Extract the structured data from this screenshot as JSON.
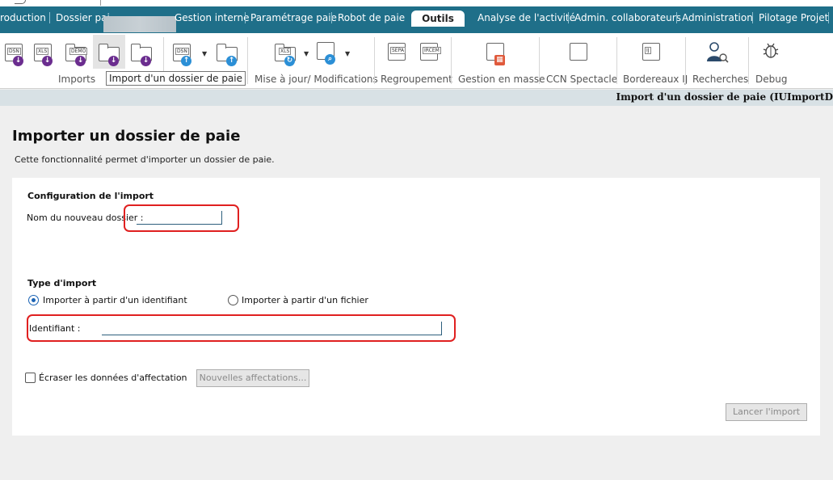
{
  "nav": {
    "tabs": [
      {
        "label": "roduction"
      },
      {
        "label": "Dossier pai"
      },
      {
        "label": "Gestion interne"
      },
      {
        "label": "Paramétrage paie"
      },
      {
        "label": "Robot de paie"
      },
      {
        "label": "Outils"
      },
      {
        "label": "Analyse de l'activité"
      },
      {
        "label": "Admin. collaborateurs"
      },
      {
        "label": "Administration"
      },
      {
        "label": "Pilotage Projet"
      }
    ],
    "active_tab": "Outils"
  },
  "ribbon": {
    "icon_tags": {
      "dsn": "DSN",
      "xls": "XLS",
      "demo": "DEMO",
      "sepa": "SEPA",
      "ircem": "IRCEM",
      "ij": "IJ"
    },
    "groups": [
      {
        "label": "Imports"
      },
      {
        "label": "Mise à jour/ Modifications"
      },
      {
        "label": "Regroupement"
      },
      {
        "label": "Gestion en masse"
      },
      {
        "label": "CCN Spectacle"
      },
      {
        "label": "Bordereaux IJ"
      },
      {
        "label": "Recherches"
      },
      {
        "label": "Debug"
      }
    ],
    "tooltip": "Import d'un dossier de paie"
  },
  "status_bar": {
    "title": "Import d'un dossier de paie (IUImportD"
  },
  "page": {
    "title": "Importer un dossier de paie",
    "description": "Cette fonctionnalité permet d'importer un dossier de paie.",
    "config_section": {
      "title": "Configuration de l'import",
      "folder_name_label": "Nom du nouveau dossier :",
      "folder_name_value": ""
    },
    "import_type_section": {
      "title": "Type d'import",
      "option_identifier": "Importer à partir d'un identifiant",
      "option_file": "Importer à partir d'un fichier",
      "selected": "identifiant",
      "identifier_label": "Identifiant :",
      "identifier_value": ""
    },
    "overwrite_label": "Écraser les données d'affectation",
    "overwrite_checked": false,
    "new_assignments_button": "Nouvelles affectations...",
    "launch_button": "Lancer l'import"
  },
  "colors": {
    "navbar": "#1f6f89",
    "highlight": "#e02020",
    "radio_selected": "#1b63b4"
  }
}
